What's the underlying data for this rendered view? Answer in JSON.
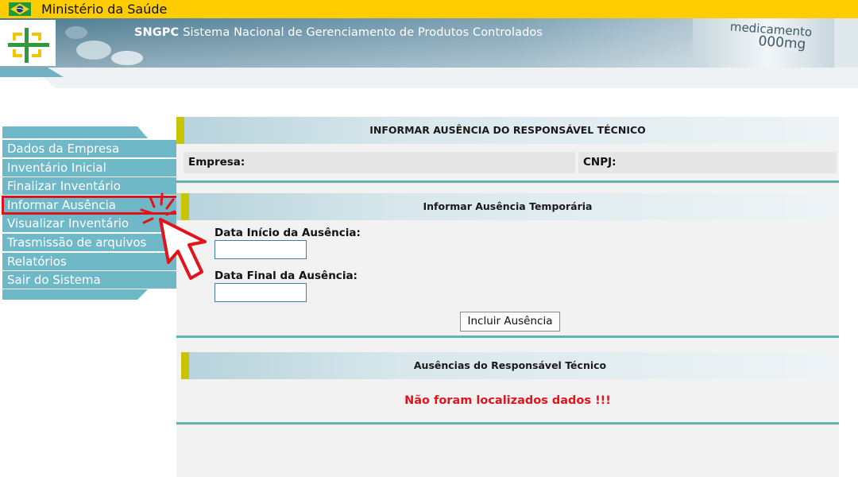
{
  "gov_bar": {
    "title": "Ministério da Saúde"
  },
  "banner": {
    "system_acronym": "SNGPC",
    "system_name": "Sistema Nacional de Gerenciamento de Produtos Controlados",
    "label_line1": "medicamento",
    "label_line2": "000mg"
  },
  "sidebar": {
    "items": [
      {
        "label": "Dados da Empresa"
      },
      {
        "label": "Inventário Inicial"
      },
      {
        "label": "Finalizar Inventário"
      },
      {
        "label": "Informar Ausência",
        "active": true
      },
      {
        "label": "Visualizar Inventário"
      },
      {
        "label": "Trasmissão de arquivos"
      },
      {
        "label": "Relatórios"
      },
      {
        "label": "Sair do Sistema"
      }
    ]
  },
  "main": {
    "page_title": "INFORMAR AUSÊNCIA DO RESPONSÁVEL TÉCNICO",
    "company": {
      "empresa_label": "Empresa:",
      "cnpj_label": "CNPJ:"
    },
    "temporary_section": {
      "title": "Informar Ausência Temporária",
      "start_label": "Data Início da Ausência:",
      "start_value": "",
      "end_label": "Data Final da Ausência:",
      "end_value": "",
      "submit_label": "Incluir Ausência"
    },
    "absences_section": {
      "title": "Ausências do Responsável Técnico",
      "empty_message": "Não foram localizados dados !!!"
    }
  },
  "colors": {
    "gov_yellow": "#ffcc00",
    "nav_teal": "#6fb8c8",
    "active_outline": "#d9141f",
    "accent_olive": "#c9c400",
    "rule_teal": "#5fb3b3",
    "error_red": "#e0141c"
  }
}
